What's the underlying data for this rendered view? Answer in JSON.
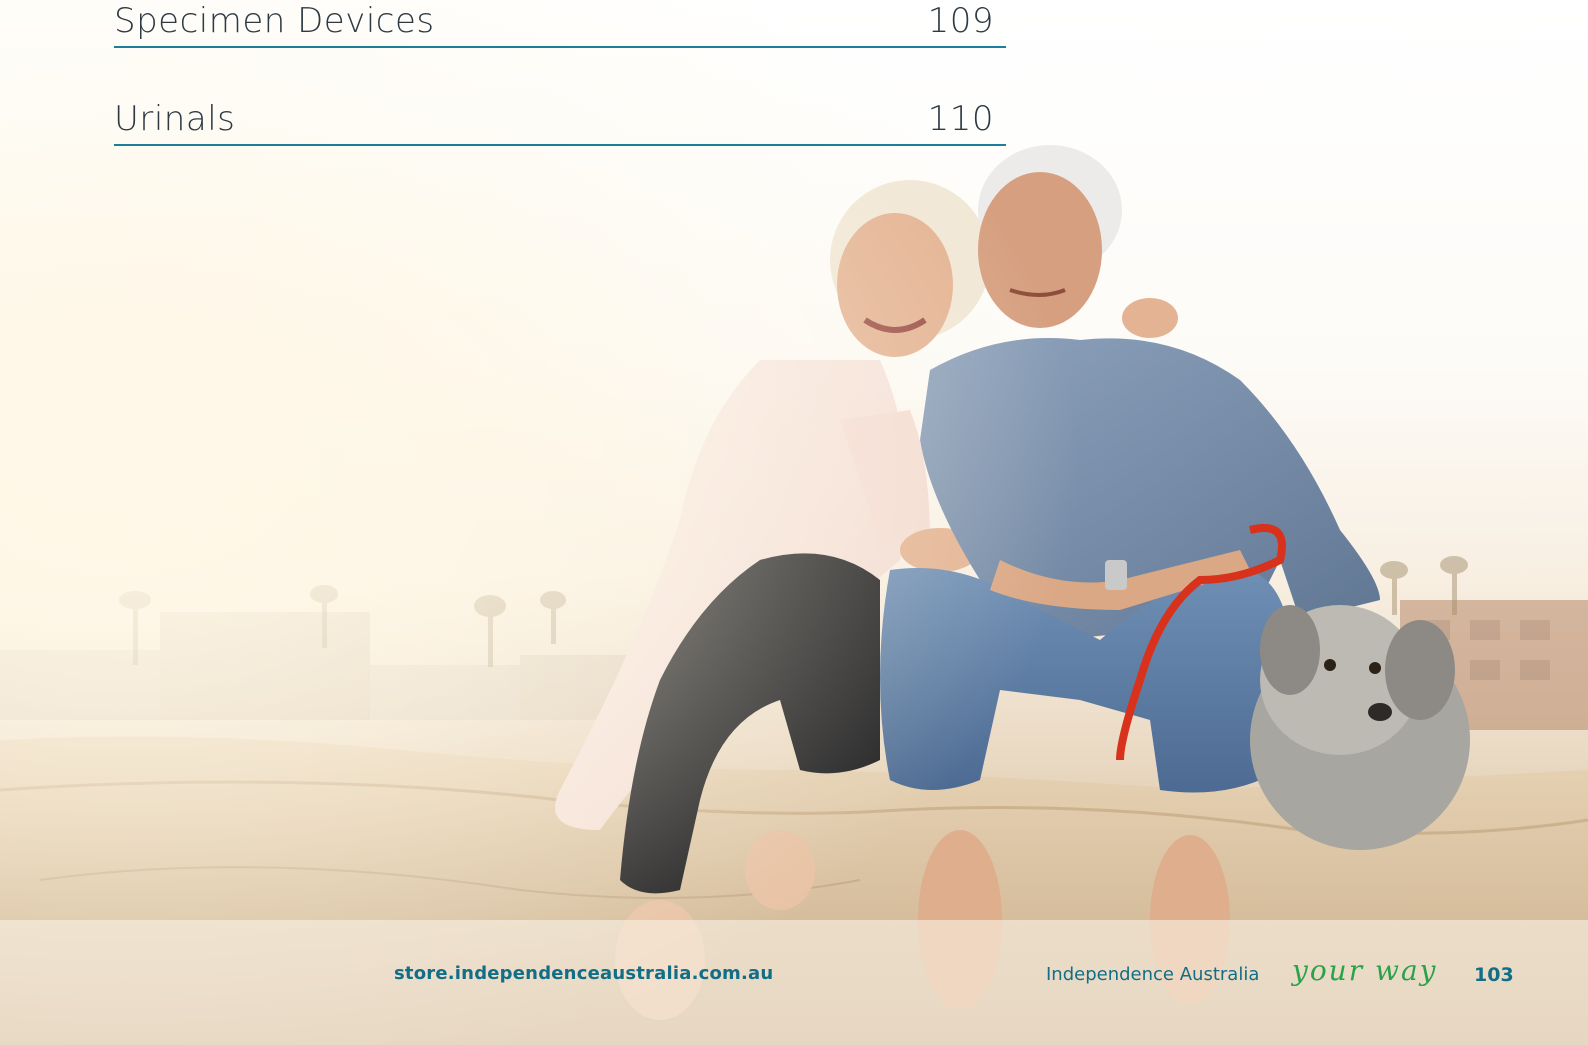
{
  "toc": {
    "items": [
      {
        "label": "Specimen Devices",
        "page": "109"
      },
      {
        "label": "Urinals",
        "page": "110"
      }
    ]
  },
  "footer": {
    "url": "store.independenceaustralia.com.au",
    "brand": "Independence Australia",
    "tagline": "your way",
    "page_number": "103"
  },
  "colors": {
    "accent_teal": "#126e86",
    "rule_line": "#1b7f99",
    "tagline_green": "#2aa24b"
  }
}
